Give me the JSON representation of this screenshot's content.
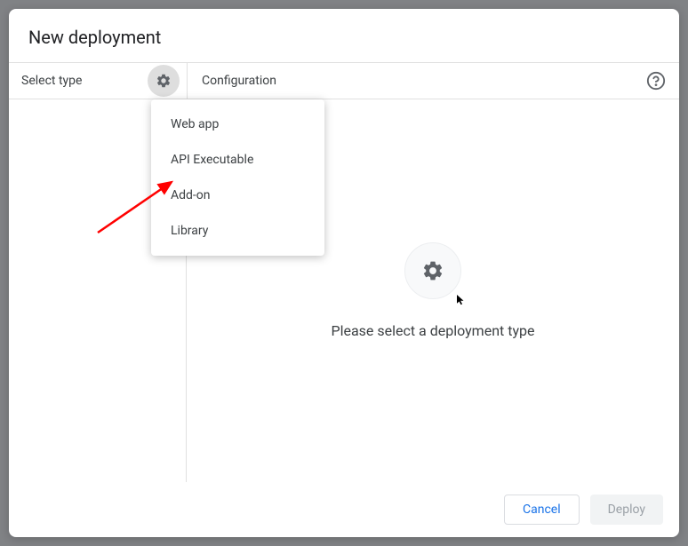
{
  "dialog": {
    "title": "New deployment"
  },
  "subheader": {
    "select_type_label": "Select type",
    "configuration_label": "Configuration"
  },
  "dropdown": {
    "items": [
      {
        "label": "Web app"
      },
      {
        "label": "API Executable"
      },
      {
        "label": "Add-on"
      },
      {
        "label": "Library"
      }
    ]
  },
  "main": {
    "placeholder_text": "Please select a deployment type"
  },
  "footer": {
    "cancel": "Cancel",
    "deploy": "Deploy"
  }
}
